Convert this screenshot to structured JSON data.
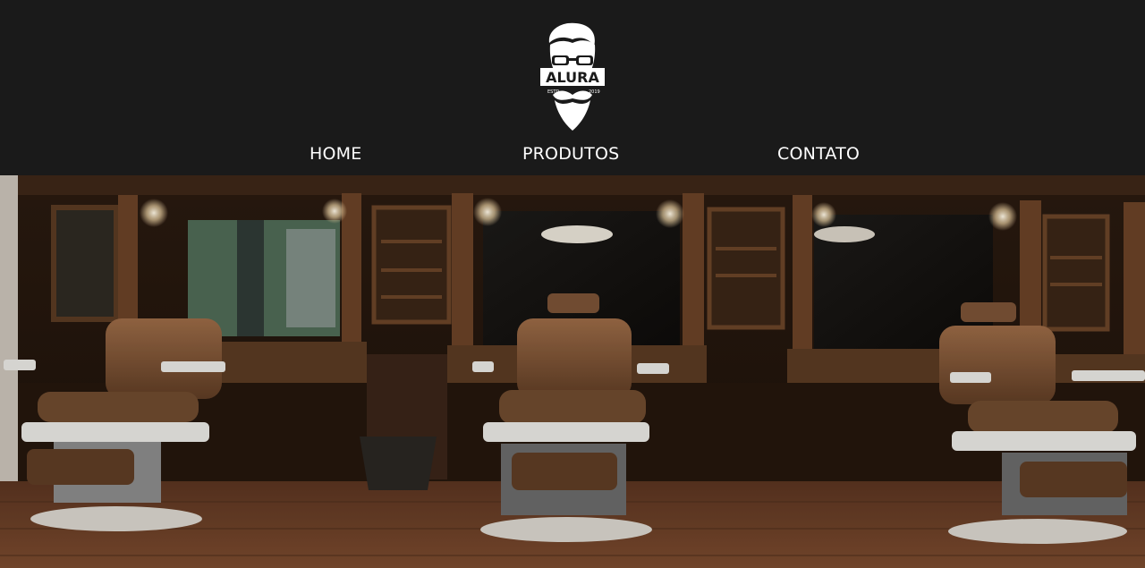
{
  "header": {
    "logo": {
      "icon": "bearded-man-with-glasses-icon",
      "brand_text": "ALURA",
      "est_text": "ESTD",
      "year_text": "2019"
    },
    "nav": [
      {
        "label": "HOME"
      },
      {
        "label": "PRODUTOS"
      },
      {
        "label": "CONTATO"
      }
    ]
  },
  "hero": {
    "image": "barbershop-interior-with-three-barber-chairs"
  },
  "colors": {
    "header_bg": "#1a1a1a",
    "nav_text": "#ffffff",
    "wood_dark": "#3a2516",
    "leather": "#7a5236",
    "floor": "#6e4228"
  }
}
